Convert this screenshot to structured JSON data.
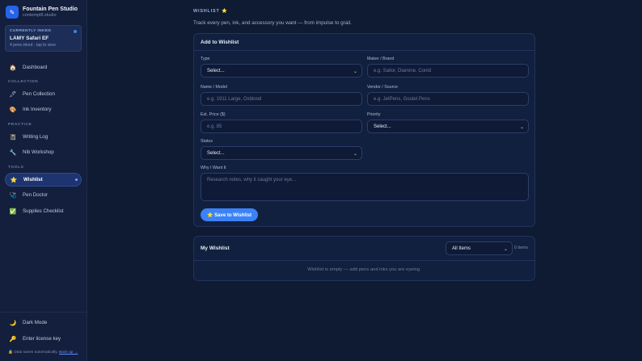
{
  "brand": {
    "logo_glyph": "✎",
    "name": "Fountain Pen Studio",
    "sub": "contempl8.studio"
  },
  "currently_inked": {
    "label": "CURRENTLY INKED",
    "pen": "LAMY Safari EF",
    "sub": "4 pens inked · tap to view"
  },
  "nav": {
    "dashboard": {
      "icon": "🏠",
      "label": "Dashboard"
    },
    "section_collection": "COLLECTION",
    "pen_collection": {
      "icon": "🖊",
      "label": "Pen Collection"
    },
    "ink_inventory": {
      "icon": "🎨",
      "label": "Ink Inventory"
    },
    "section_practice": "PRACTICE",
    "writing_log": {
      "icon": "📓",
      "label": "Writing Log"
    },
    "nib_workshop": {
      "icon": "🔧",
      "label": "Nib Workshop"
    },
    "section_tools": "TOOLS",
    "wishlist": {
      "icon": "⭐",
      "label": "Wishlist"
    },
    "pen_doctor": {
      "icon": "🩺",
      "label": "Pen Doctor"
    },
    "supplies_checklist": {
      "icon": "✅",
      "label": "Supplies Checklist"
    }
  },
  "footer": {
    "dark_mode": {
      "icon": "🌙",
      "label": "Dark Mode"
    },
    "license": {
      "icon": "🔑",
      "label": "Enter license key"
    },
    "note_icon": "🔒",
    "note": "Data saves automatically.",
    "note_link": "Back up →"
  },
  "page": {
    "kicker": "WISHLIST ⭐",
    "description": "Track every pen, ink, and accessory you want — from impulse to grail."
  },
  "add_form": {
    "title": "Add to Wishlist",
    "type": {
      "label": "Type",
      "value": "Select..."
    },
    "maker": {
      "label": "Maker / Brand",
      "placeholder": "e.g. Sailor, Diamine, Conid"
    },
    "name": {
      "label": "Name / Model",
      "placeholder": "e.g. 1911 Large, Oxblood"
    },
    "vendor": {
      "label": "Vendor / Source",
      "placeholder": "e.g. JetPens, Goulet Pens"
    },
    "price": {
      "label": "Est. Price ($)",
      "placeholder": "e.g. 85"
    },
    "priority": {
      "label": "Priority",
      "value": "Select..."
    },
    "status": {
      "label": "Status",
      "value": "Select..."
    },
    "why": {
      "label": "Why I Want It",
      "placeholder": "Research notes, why it caught your eye..."
    },
    "save": "⭐ Save to Wishlist"
  },
  "my_wishlist": {
    "title": "My Wishlist",
    "filter": "All Items",
    "count": "0 items",
    "empty": "Wishlist is empty — add pens and inks you are eyeing."
  },
  "colors": {
    "accent": "#3b82f6",
    "background": "#0f1a33",
    "sidebar": "#131f3c"
  }
}
